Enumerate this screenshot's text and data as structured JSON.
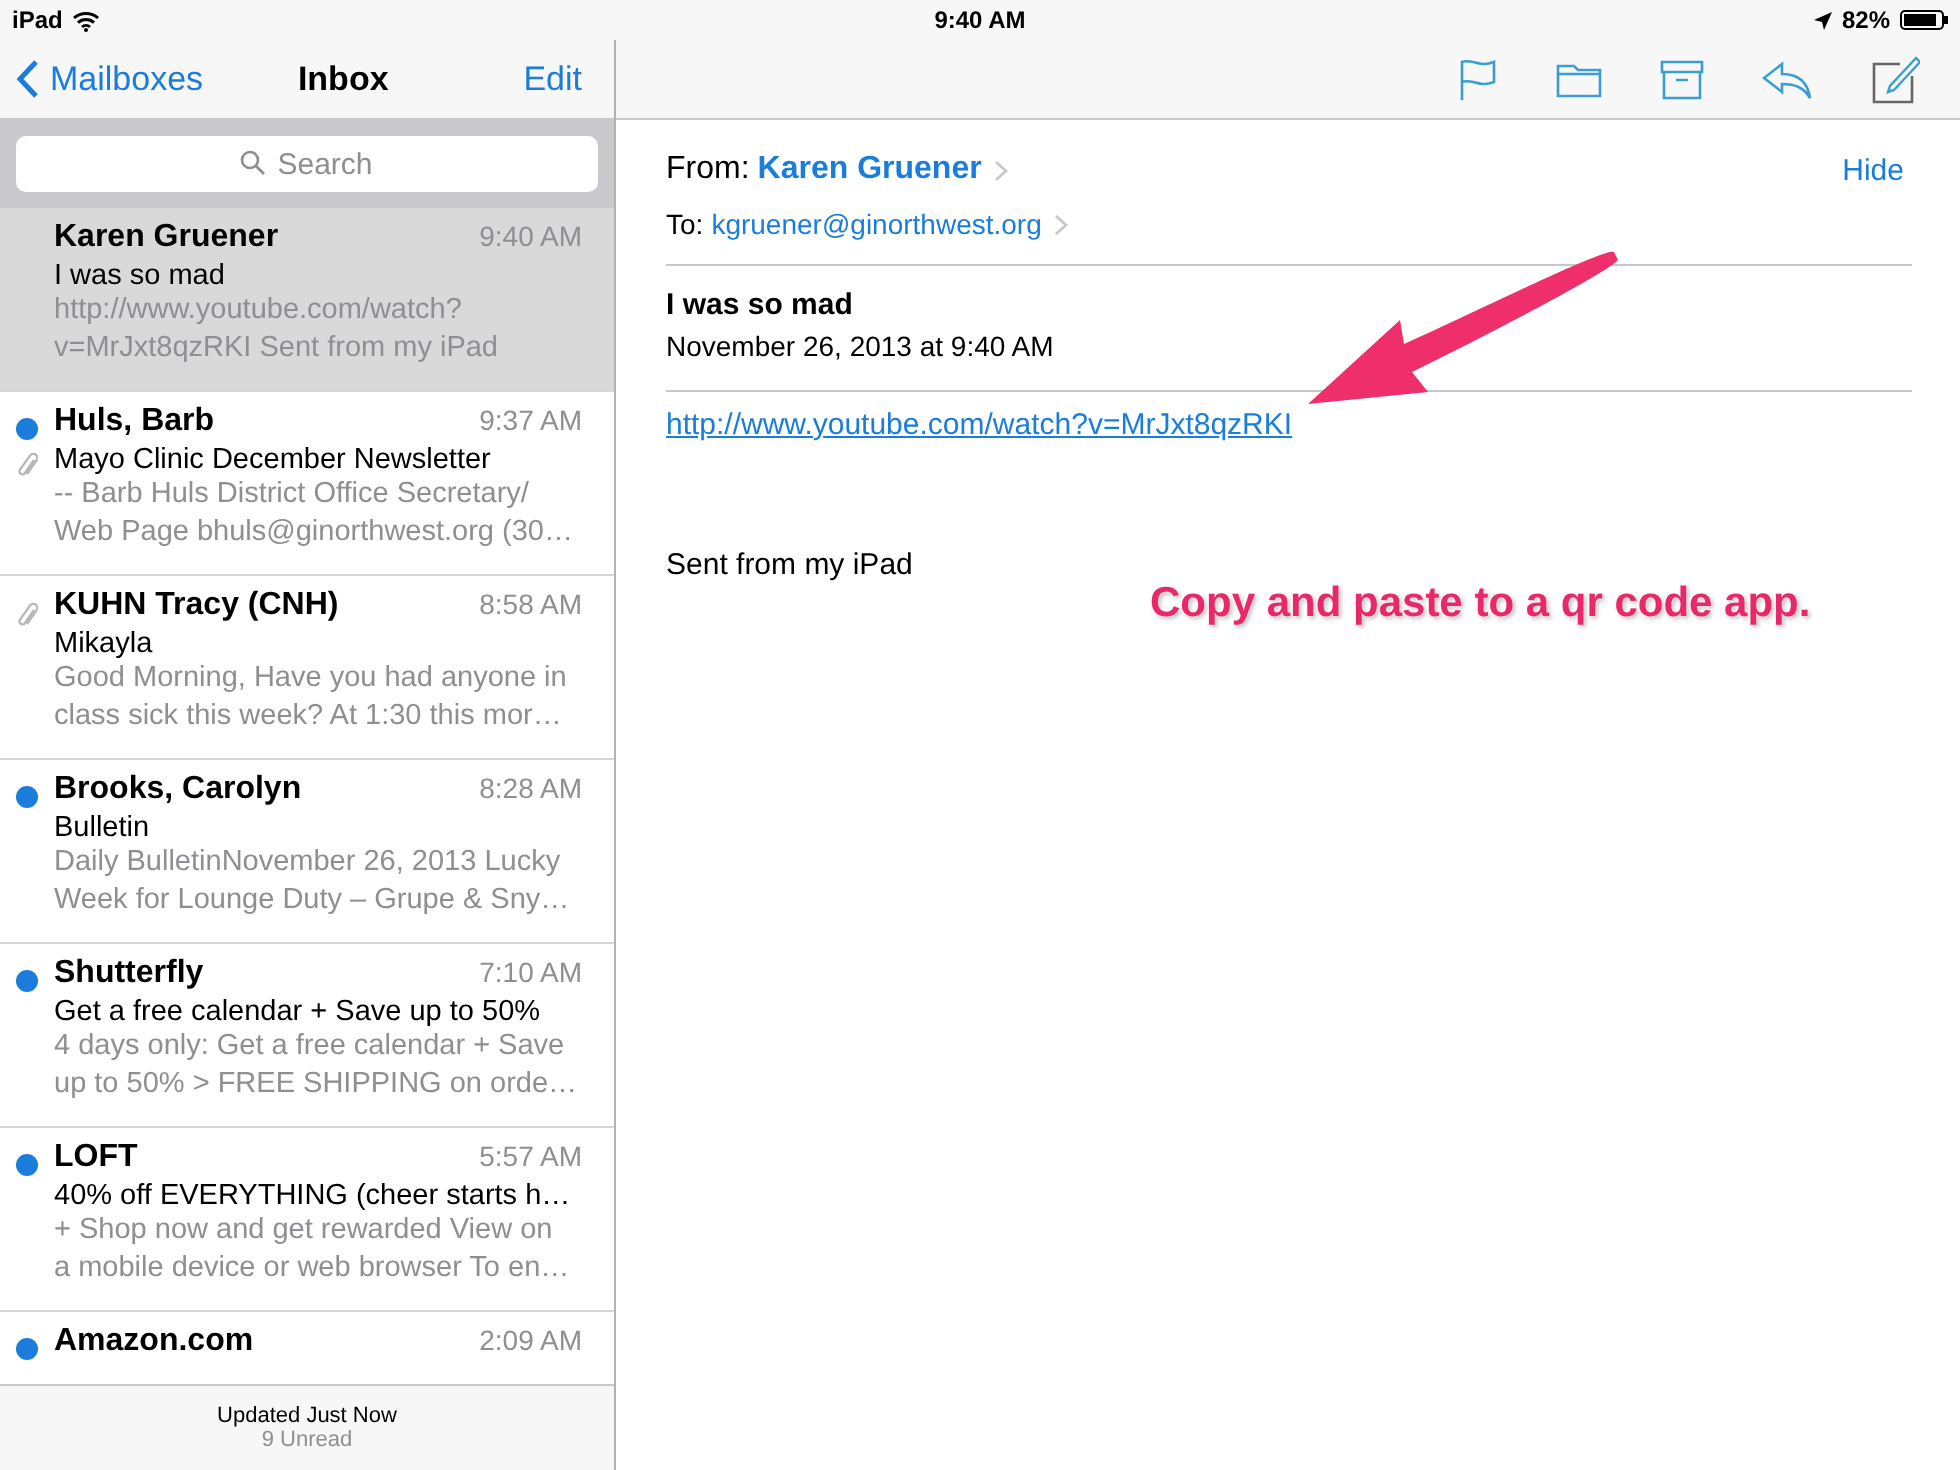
{
  "status_bar": {
    "carrier": "iPad",
    "time": "9:40 AM",
    "battery": "82%"
  },
  "nav": {
    "back": "Mailboxes",
    "title": "Inbox",
    "edit": "Edit"
  },
  "search": {
    "placeholder": "Search"
  },
  "messages": [
    {
      "sender": "Karen Gruener",
      "time": "9:40 AM",
      "subject": "I was so mad",
      "preview": [
        "http://www.youtube.com/watch?",
        "v=MrJxt8qzRKI Sent from my iPad"
      ],
      "unread": false,
      "attachment": false,
      "selected": true
    },
    {
      "sender": "Huls, Barb",
      "time": "9:37 AM",
      "subject": "Mayo Clinic December Newsletter",
      "preview": [
        "-- Barb Huls District Office Secretary/",
        "Web Page bhuls@ginorthwest.org (30…"
      ],
      "unread": true,
      "attachment": true,
      "selected": false
    },
    {
      "sender": "KUHN Tracy (CNH)",
      "time": "8:58 AM",
      "subject": "Mikayla",
      "preview": [
        "Good Morning, Have you had anyone in",
        "class sick this week? At 1:30 this mor…"
      ],
      "unread": false,
      "attachment": true,
      "selected": false
    },
    {
      "sender": "Brooks, Carolyn",
      "time": "8:28 AM",
      "subject": "Bulletin",
      "preview": [
        "Daily BulletinNovember 26, 2013 Lucky",
        "Week for Lounge Duty – Grupe & Sny…"
      ],
      "unread": true,
      "attachment": false,
      "selected": false
    },
    {
      "sender": "Shutterfly",
      "time": "7:10 AM",
      "subject": "Get a free calendar + Save up to 50%",
      "preview": [
        "4 days only: Get a free calendar + Save",
        "up to 50% > FREE SHIPPING on orde…"
      ],
      "unread": true,
      "attachment": false,
      "selected": false
    },
    {
      "sender": "LOFT",
      "time": "5:57 AM",
      "subject": "40% off EVERYTHING (cheer starts h…",
      "preview": [
        "+ Shop now and get rewarded View on",
        "a mobile device or web browser To en…"
      ],
      "unread": true,
      "attachment": false,
      "selected": false
    },
    {
      "sender": "Amazon.com",
      "time": "2:09 AM",
      "unread": true,
      "attachment": false,
      "selected": false
    }
  ],
  "footer": {
    "updated": "Updated Just Now",
    "unread": "9 Unread"
  },
  "email": {
    "from_label": "From:",
    "from": "Karen Gruener",
    "hide": "Hide",
    "to_label": "To:",
    "to": "kgruener@ginorthwest.org",
    "subject": "I was so mad",
    "date": "November 26, 2013 at 9:40 AM",
    "link": "http://www.youtube.com/watch?v=MrJxt8qzRKI",
    "body": "Sent from my iPad"
  },
  "annotation": {
    "text": "Copy and paste to a qr code app."
  }
}
